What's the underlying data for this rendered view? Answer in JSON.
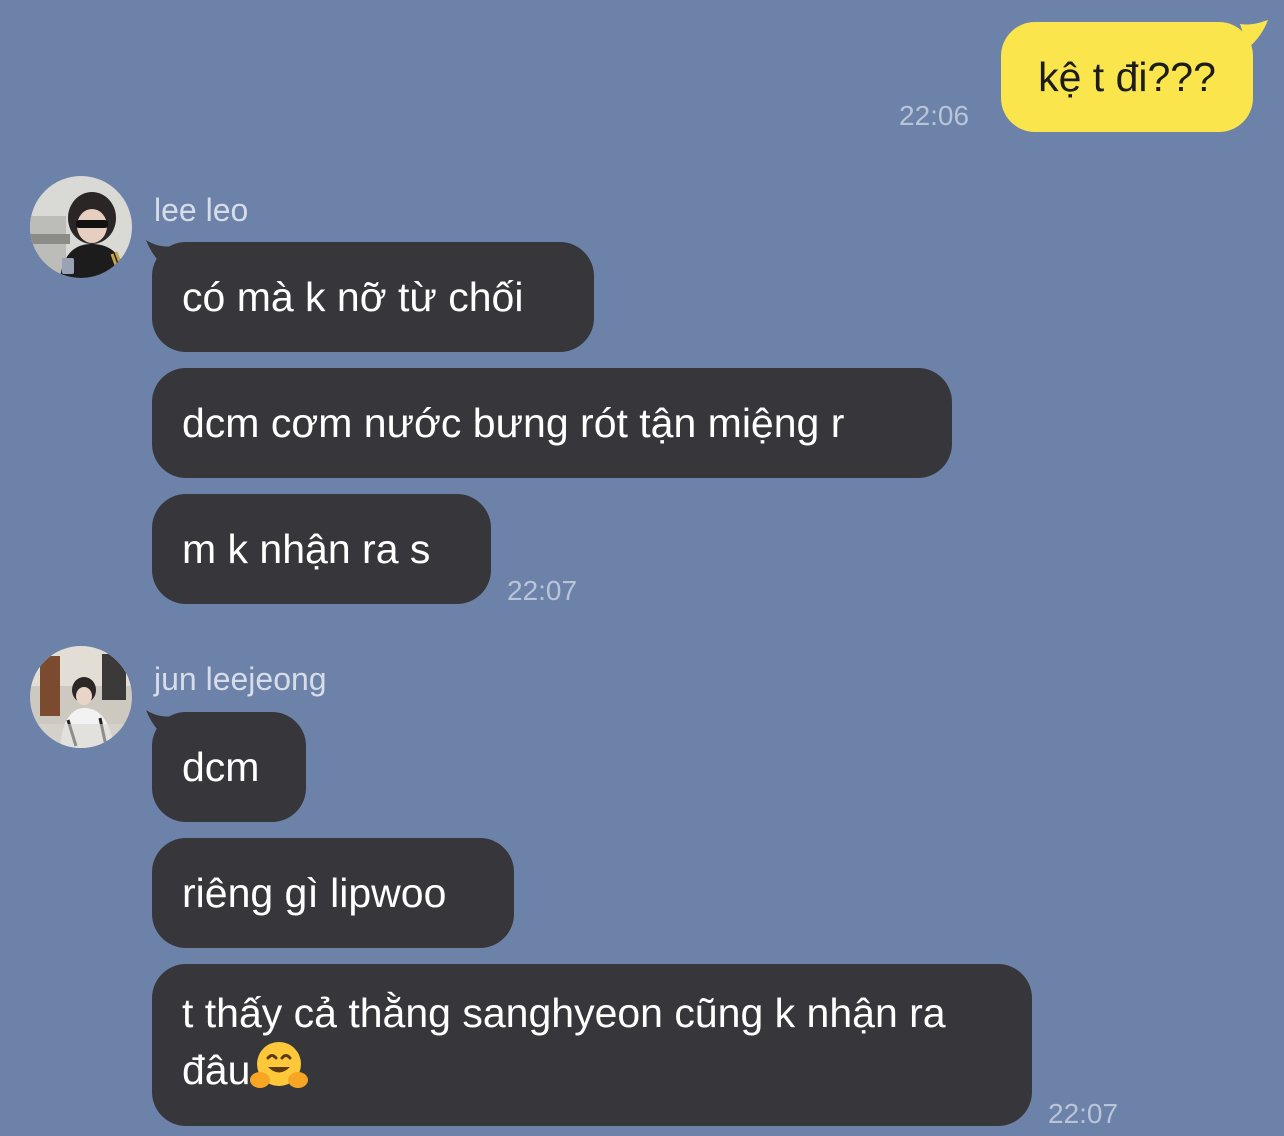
{
  "outgoing": [
    {
      "text": "kệ t đi???",
      "time": "22:06"
    }
  ],
  "groups": [
    {
      "sender": "lee leo",
      "avatar_icon": "avatar-photo-lee-leo",
      "messages": [
        "có mà k nỡ từ chối",
        "dcm cơm nước bưng rót tận miệng r",
        "m k nhận ra s"
      ],
      "time": "22:07"
    },
    {
      "sender": "jun leejeong",
      "avatar_icon": "avatar-photo-jun-leejeong",
      "messages": [
        "dcm",
        "riêng gì lipwoo",
        "t thấy cả thằng sanghyeon cũng k nhận ra đâu"
      ],
      "emoji": "hugging-face-emoji",
      "time": "22:07"
    }
  ],
  "colors": {
    "background": "#6d82a9",
    "incoming_bubble": "#37373b",
    "outgoing_bubble": "#fbe54d",
    "timestamp": "#b9c4d9",
    "sender_name": "#d6dde9"
  }
}
